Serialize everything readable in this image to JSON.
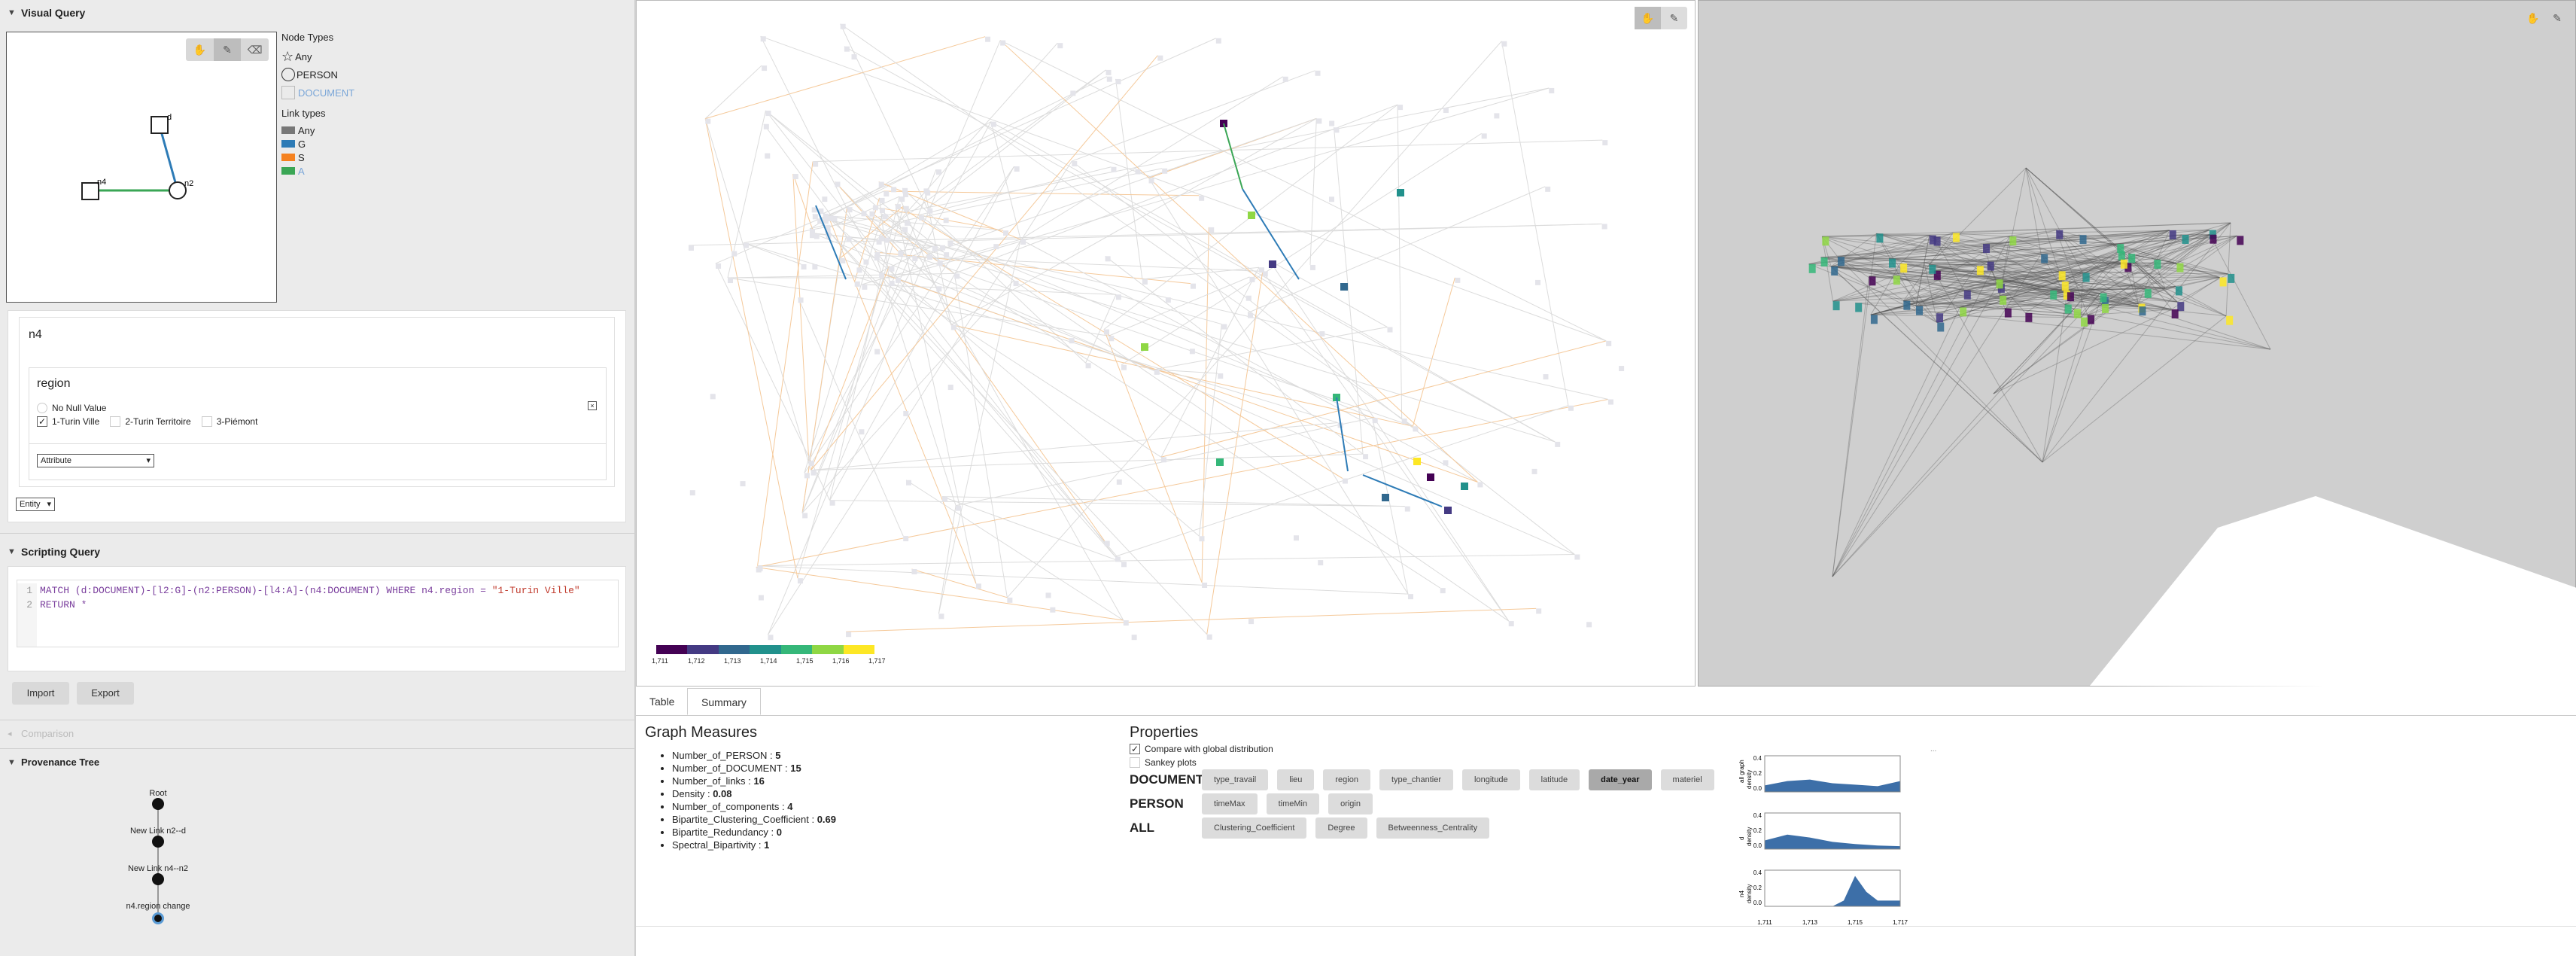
{
  "left": {
    "visual_query": {
      "title": "Visual Query",
      "node_types_title": "Node Types",
      "node_types": [
        "Any",
        "PERSON",
        "DOCUMENT"
      ],
      "link_types_title": "Link types",
      "link_types": [
        {
          "label": "Any",
          "color": "#777777"
        },
        {
          "label": "G",
          "color": "#2d7bb6"
        },
        {
          "label": "S",
          "color": "#f58220"
        },
        {
          "label": "A",
          "color": "#3aa655"
        }
      ],
      "nodes": {
        "d": "d",
        "n2": "n2",
        "n4": "n4"
      }
    },
    "node_panel": {
      "node_name": "n4",
      "attribute_name": "region",
      "no_null_label": "No Null Value",
      "options": [
        {
          "label": "1-Turin Ville",
          "checked": true
        },
        {
          "label": "2-Turin Territoire",
          "checked": false
        },
        {
          "label": "3-Piémont",
          "checked": false
        }
      ],
      "attribute_select": "Attribute",
      "entity_select": "Entity"
    },
    "scripting": {
      "title": "Scripting Query",
      "line1_num": "1",
      "line1_a": "MATCH (d:DOCUMENT)-[l2:G]-(n2:PERSON)-[l4:A]-(n4:DOCUMENT) WHERE n4.region = ",
      "line1_b": "\"1-Turin Ville\"",
      "line2_num": "2",
      "line2": "RETURN *",
      "import_label": "Import",
      "export_label": "Export"
    },
    "comparison": {
      "title": "Comparison"
    },
    "provenance": {
      "title": "Provenance Tree",
      "items": [
        "Root",
        "New Link n2--d",
        "New Link n4--n2",
        "n4.region change"
      ]
    }
  },
  "graph2d": {
    "scale_ticks": [
      "1,711",
      "1,712",
      "1,713",
      "1,714",
      "1,715",
      "1,716",
      "1,717"
    ],
    "scale_colors": [
      "#440154",
      "#443a83",
      "#31688e",
      "#21918c",
      "#35b779",
      "#8fd744",
      "#fde725"
    ]
  },
  "bottom": {
    "tabs": [
      "Table",
      "Summary"
    ],
    "active_tab": "Summary",
    "measures_title": "Graph Measures",
    "measures": [
      {
        "key": "Number_of_PERSON :",
        "value": "5"
      },
      {
        "key": "Number_of_DOCUMENT :",
        "value": "15"
      },
      {
        "key": "Number_of_links :",
        "value": "16"
      },
      {
        "key": "Density :",
        "value": "0.08"
      },
      {
        "key": "Number_of_components :",
        "value": "4"
      },
      {
        "key": "Bipartite_Clustering_Coefficient :",
        "value": "0.69"
      },
      {
        "key": "Bipartite_Redundancy :",
        "value": "0"
      },
      {
        "key": "Spectral_Bipartivity :",
        "value": "1"
      }
    ],
    "properties_title": "Properties",
    "compare_label": "Compare with global distribution",
    "sankey_label": "Sankey plots",
    "groups": [
      {
        "label": "DOCUMENT",
        "props": [
          "type_travail",
          "lieu",
          "region",
          "type_chantier",
          "longitude",
          "latitude",
          "date_year",
          "materiel"
        ],
        "selected": "date_year"
      },
      {
        "label": "PERSON",
        "props": [
          "timeMax",
          "timeMin",
          "origin"
        ],
        "selected": ""
      },
      {
        "label": "ALL",
        "props": [
          "Clustering_Coefficient",
          "Degree",
          "Betweenness_Centrality"
        ],
        "selected": ""
      }
    ],
    "more_label": "...",
    "charts": {
      "x_ticks": [
        "1,711",
        "1,713",
        "1,715",
        "1,717"
      ],
      "y_label": "density",
      "y_ticks": [
        "0.4",
        "0.2",
        "0.0"
      ],
      "panels": [
        "all graph",
        "d",
        "n4"
      ]
    }
  },
  "chart_data": [
    {
      "type": "area",
      "title": "",
      "xlabel": "",
      "ylabel": "density",
      "series": [
        {
          "name": "all graph",
          "x": [
            1711,
            1712,
            1713,
            1714,
            1715,
            1716,
            1717
          ],
          "values": [
            0.09,
            0.15,
            0.17,
            0.12,
            0.1,
            0.08,
            0.15
          ]
        }
      ],
      "xlim": [
        1711,
        1717
      ],
      "ylim": [
        0,
        0.5
      ]
    },
    {
      "type": "area",
      "title": "",
      "xlabel": "",
      "ylabel": "density",
      "series": [
        {
          "name": "d",
          "x": [
            1711,
            1712,
            1713,
            1714,
            1715,
            1716,
            1717
          ],
          "values": [
            0.12,
            0.2,
            0.16,
            0.1,
            0.07,
            0.05,
            0.04
          ]
        }
      ],
      "xlim": [
        1711,
        1717
      ],
      "ylim": [
        0,
        0.5
      ]
    },
    {
      "type": "area",
      "title": "",
      "xlabel": "",
      "ylabel": "density",
      "series": [
        {
          "name": "n4",
          "x": [
            1711,
            1712,
            1713,
            1714,
            1714.5,
            1715,
            1715.5,
            1716,
            1717
          ],
          "values": [
            0,
            0,
            0,
            0,
            0.08,
            0.42,
            0.2,
            0.08,
            0.08
          ]
        }
      ],
      "xlim": [
        1711,
        1717
      ],
      "ylim": [
        0,
        0.5
      ]
    }
  ]
}
